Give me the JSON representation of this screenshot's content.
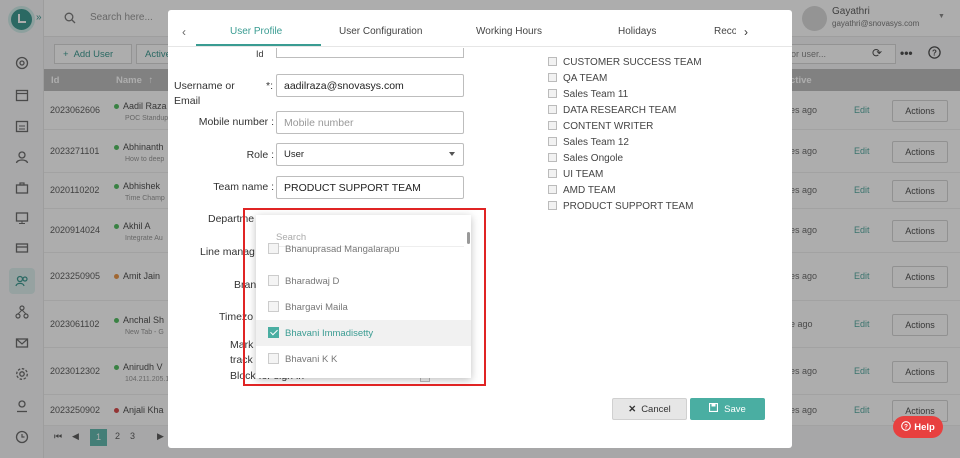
{
  "topbar": {
    "search_placeholder": "Search here...",
    "user_name": "Gayathri",
    "user_email": "gayathri@snovasys.com"
  },
  "toolbar": {
    "add_user_label": "Add User",
    "active_label": "Active",
    "filter_placeholder": "or user..."
  },
  "table": {
    "headers": {
      "id": "Id",
      "name": "Name",
      "active": "ctive"
    },
    "rows": [
      {
        "id": "2023062606",
        "name": "Aadil Raza",
        "sub": "POC Standup",
        "status_color": "#3ab54a",
        "time": "es ago"
      },
      {
        "id": "2023271101",
        "name": "Abhinanth",
        "sub": "How to deep",
        "status_color": "#3ab54a",
        "time": "es ago"
      },
      {
        "id": "2020110202",
        "name": "Abhishek",
        "sub": "Time Champ",
        "status_color": "#3ab54a",
        "time": "es ago"
      },
      {
        "id": "2020914024",
        "name": "Akhil A",
        "sub": "Integrate Au",
        "status_color": "#3ab54a",
        "time": "es ago"
      },
      {
        "id": "2023250905",
        "name": "Amit Jain",
        "sub": "",
        "status_color": "#e8872b",
        "time": "es ago"
      },
      {
        "id": "2023061102",
        "name": "Anchal Sh",
        "sub": "New Tab - G",
        "status_color": "#3ab54a",
        "time": "e ago"
      },
      {
        "id": "2023012302",
        "name": "Anirudh V",
        "sub": "104.211.205.16",
        "status_color": "#3ab54a",
        "time": "es ago"
      },
      {
        "id": "2023250902",
        "name": "Anjali Kha",
        "sub": "",
        "status_color": "#d32f2f",
        "time": "es ago"
      }
    ],
    "edit_label": "Edit",
    "actions_label": "Actions"
  },
  "pager": {
    "pages": [
      "1",
      "2",
      "3"
    ],
    "current": "1"
  },
  "modal": {
    "tabs": [
      "User Profile",
      "User Configuration",
      "Working Hours",
      "Holidays",
      "Reco"
    ],
    "form": {
      "id_label": "Id",
      "username_label": "Username or Email",
      "username_required": "*:",
      "username_value": "aadilraza@snovasys.com",
      "mobile_label": "Mobile number :",
      "mobile_placeholder": "Mobile number",
      "role_label": "Role :",
      "role_value": "User",
      "team_label": "Team name :",
      "team_value": "PRODUCT SUPPORT TEAM",
      "department_label": "Departme",
      "line_manager_label": "Line manag",
      "branch_label": "Bran",
      "timezone_label": "Timezo",
      "mark_label": "Mark",
      "track_label": "track",
      "block_label": "Block for sign in"
    },
    "teams": [
      "CUSTOMER SUCCESS TEAM",
      "QA TEAM",
      "Sales Team 11",
      "DATA RESEARCH TEAM",
      "CONTENT WRITER",
      "Sales Team 12",
      "Sales Ongole",
      "UI TEAM",
      "AMD TEAM",
      "PRODUCT SUPPORT TEAM"
    ],
    "dropdown": {
      "search_placeholder": "Search",
      "items": [
        {
          "label": "Bhanuprasad Mangalarapu",
          "checked": false
        },
        {
          "label": "Bharadwaj D",
          "checked": false
        },
        {
          "label": "Bhargavi Maila",
          "checked": false
        },
        {
          "label": "Bhavani Immadisetty",
          "checked": true
        },
        {
          "label": "Bhavani K K",
          "checked": false
        }
      ]
    },
    "cancel_label": "Cancel",
    "save_label": "Save"
  },
  "help_label": "Help",
  "colors": {
    "accent": "#3a9c92",
    "help": "#e8403f",
    "highlight": "#e02424"
  }
}
